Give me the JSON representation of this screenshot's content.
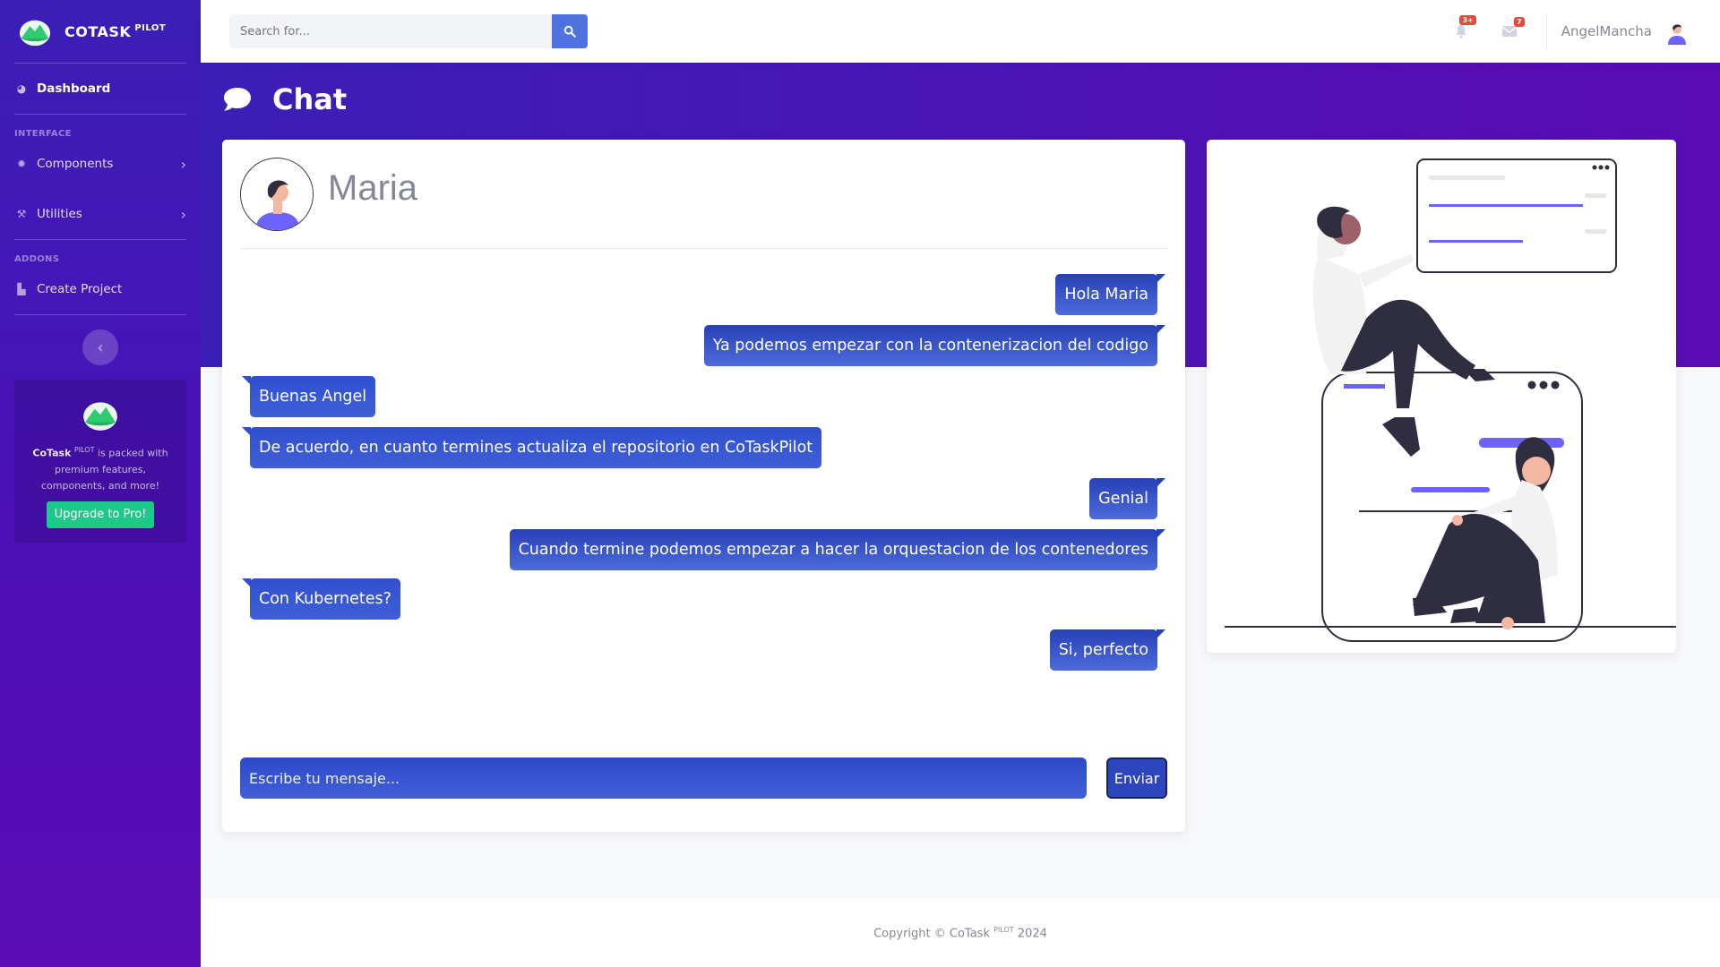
{
  "brand": {
    "name": "COTASK",
    "sup": "PILOT",
    "logo_icon": "mountain-logo"
  },
  "sidebar": {
    "dashboard": "Dashboard",
    "section_interface": "INTERFACE",
    "components": "Components",
    "utilities": "Utilities",
    "section_addons": "ADDONS",
    "create_project": "Create Project",
    "promo": {
      "brand": "CoTask",
      "brand_sup": "PILOT",
      "text": " is packed with premium features, components, and more!",
      "button": "Upgrade to Pro!"
    }
  },
  "topbar": {
    "search_placeholder": "Search for...",
    "alerts_badge": "3+",
    "messages_badge": "7",
    "user_name": "AngelMancha"
  },
  "page": {
    "title": "Chat"
  },
  "chat": {
    "contact_name": "Maria",
    "messages": [
      {
        "dir": "out",
        "text": "Hola Maria"
      },
      {
        "dir": "out",
        "text": "Ya podemos empezar con la contenerizacion del codigo"
      },
      {
        "dir": "in",
        "text": "Buenas Angel"
      },
      {
        "dir": "in",
        "text": "De acuerdo, en cuanto termines actualiza el repositorio en CoTaskPilot"
      },
      {
        "dir": "out",
        "text": "Genial"
      },
      {
        "dir": "out",
        "text": "Cuando termine podemos empezar a hacer la orquestacion de los contenedores"
      },
      {
        "dir": "in",
        "text": "Con Kubernetes?"
      },
      {
        "dir": "out",
        "text": "Si, perfecto"
      }
    ],
    "input_placeholder": "Escribe tu mensaje...",
    "send_label": "Enviar"
  },
  "footer": {
    "prefix": "Copyright © CoTask",
    "sup": "PILOT",
    "year": "2024"
  },
  "colors": {
    "primary": "#4e73df",
    "sidebar": "#3a1fb6",
    "success": "#1cc88a",
    "danger": "#e74a3b",
    "accent": "#6c63ff"
  }
}
